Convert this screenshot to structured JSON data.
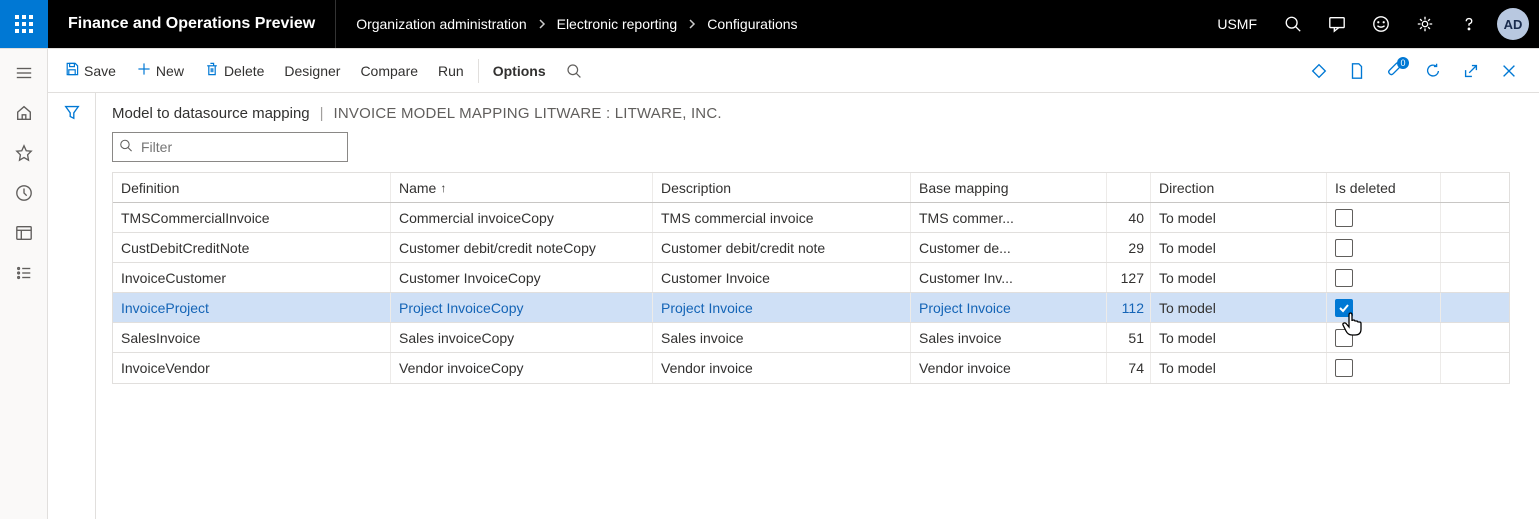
{
  "app": {
    "title": "Finance and Operations Preview",
    "company": "USMF",
    "avatar": "AD"
  },
  "breadcrumb": [
    "Organization administration",
    "Electronic reporting",
    "Configurations"
  ],
  "toolbar": {
    "save": "Save",
    "new": "New",
    "delete": "Delete",
    "designer": "Designer",
    "compare": "Compare",
    "run": "Run",
    "options": "Options"
  },
  "page": {
    "title": "Model to datasource mapping",
    "subtitle": "INVOICE MODEL MAPPING LITWARE : LITWARE, INC.",
    "filter_placeholder": "Filter"
  },
  "grid": {
    "columns": {
      "definition": "Definition",
      "name": "Name",
      "description": "Description",
      "base": "Base mapping",
      "direction": "Direction",
      "deleted": "Is deleted"
    },
    "rows": [
      {
        "def": "TMSCommercialInvoice",
        "name": "Commercial invoiceCopy",
        "desc": "TMS commercial invoice",
        "base": "TMS commer...",
        "num": "40",
        "dir": "To model",
        "del": false,
        "sel": false
      },
      {
        "def": "CustDebitCreditNote",
        "name": "Customer debit/credit noteCopy",
        "desc": "Customer debit/credit note",
        "base": "Customer de...",
        "num": "29",
        "dir": "To model",
        "del": false,
        "sel": false
      },
      {
        "def": "InvoiceCustomer",
        "name": "Customer InvoiceCopy",
        "desc": "Customer Invoice",
        "base": "Customer Inv...",
        "num": "127",
        "dir": "To model",
        "del": false,
        "sel": false
      },
      {
        "def": "InvoiceProject",
        "name": "Project InvoiceCopy",
        "desc": "Project Invoice",
        "base": "Project Invoice",
        "num": "112",
        "dir": "To model",
        "del": true,
        "sel": true
      },
      {
        "def": "SalesInvoice",
        "name": "Sales invoiceCopy",
        "desc": "Sales invoice",
        "base": "Sales invoice",
        "num": "51",
        "dir": "To model",
        "del": false,
        "sel": false
      },
      {
        "def": "InvoiceVendor",
        "name": "Vendor invoiceCopy",
        "desc": "Vendor invoice",
        "base": "Vendor invoice",
        "num": "74",
        "dir": "To model",
        "del": false,
        "sel": false
      }
    ]
  }
}
